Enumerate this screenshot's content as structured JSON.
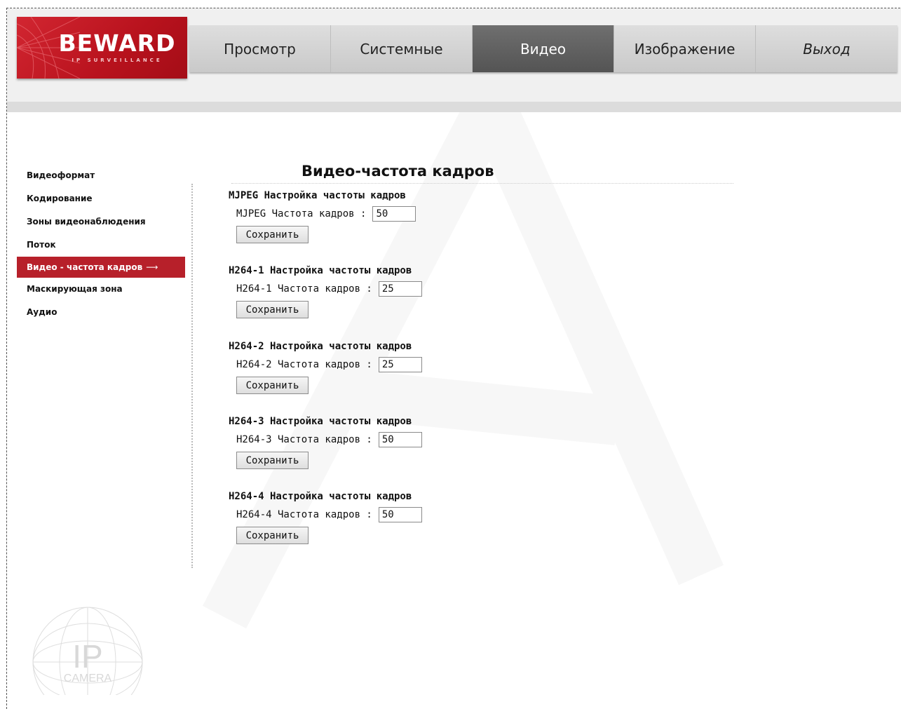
{
  "logo": {
    "brand": "BEWARD",
    "subtitle": "IP SURVEILLANCE"
  },
  "nav": {
    "items": [
      {
        "label": "Просмотр",
        "active": false
      },
      {
        "label": "Системные",
        "active": false
      },
      {
        "label": "Видео",
        "active": true
      },
      {
        "label": "Изображение",
        "active": false
      },
      {
        "label": "Выход",
        "active": false
      }
    ]
  },
  "sidebar": {
    "items": [
      {
        "label": "Видеоформат",
        "active": false
      },
      {
        "label": "Кодирование",
        "active": false
      },
      {
        "label": "Зоны видеонаблюдения",
        "active": false
      },
      {
        "label": "Поток",
        "active": false
      },
      {
        "label": "Видео - частота кадров",
        "active": true,
        "arrow": "⟶"
      },
      {
        "label": "Маскирующая зона",
        "active": false
      },
      {
        "label": "Аудио",
        "active": false
      }
    ]
  },
  "main": {
    "title": "Видео-частота кадров",
    "sections": [
      {
        "title": "MJPEG Настройка частоты кадров",
        "label": "MJPEG Частота кадров :",
        "value": "50",
        "button": "Сохранить"
      },
      {
        "title": "H264-1 Настройка частоты кадров",
        "label": "H264-1 Частота кадров :",
        "value": "25",
        "button": "Сохранить"
      },
      {
        "title": "H264-2 Настройка частоты кадров",
        "label": "H264-2 Частота кадров :",
        "value": "25",
        "button": "Сохранить"
      },
      {
        "title": "H264-3 Настройка частоты кадров",
        "label": "H264-3 Частота кадров :",
        "value": "50",
        "button": "Сохранить"
      },
      {
        "title": "H264-4 Настройка частоты кадров",
        "label": "H264-4 Частота кадров :",
        "value": "50",
        "button": "Сохранить"
      }
    ]
  },
  "footer_logo": {
    "main": "IP",
    "sub": "CAMERA"
  },
  "colors": {
    "accent_red": "#b7202a",
    "nav_active": "#5f5f5f",
    "nav_bg": "#d3d3d3"
  }
}
